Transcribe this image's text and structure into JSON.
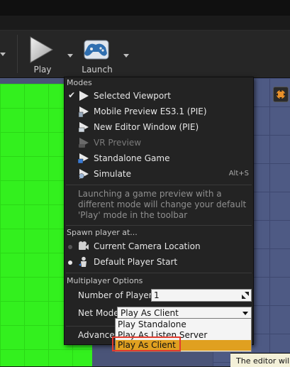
{
  "toolbar": {
    "play_label": "Play",
    "launch_label": "Launch"
  },
  "menu": {
    "modes_title": "Modes",
    "modes": [
      {
        "label": "Selected Viewport",
        "checked": true,
        "icon": "play-viewport-icon"
      },
      {
        "label": "Mobile Preview ES3.1 (PIE)",
        "icon": "play-mobile-icon"
      },
      {
        "label": "New Editor Window (PIE)",
        "icon": "play-window-icon"
      },
      {
        "label": "VR Preview",
        "disabled": true,
        "icon": "play-vr-icon"
      },
      {
        "label": "Standalone Game",
        "icon": "play-standalone-icon"
      },
      {
        "label": "Simulate",
        "shortcut": "Alt+S",
        "icon": "simulate-icon"
      }
    ],
    "description": "Launching a game preview with a different mode will change your default 'Play' mode in the toolbar",
    "spawn_title": "Spawn player at...",
    "spawn": [
      {
        "label": "Current Camera Location",
        "selected": false
      },
      {
        "label": "Default Player Start",
        "selected": true
      }
    ],
    "multiplayer_title": "Multiplayer Options",
    "num_players_label": "Number of Players",
    "num_players_value": "1",
    "net_mode_label": "Net Mode",
    "net_mode_value": "Play As Client",
    "advanced_label": "Advanced Settings..."
  },
  "net_mode_options": [
    {
      "label": "Play Standalone"
    },
    {
      "label": "Play As Listen Server"
    },
    {
      "label": "Play As Client",
      "selected": true
    }
  ],
  "tooltip_fragment": "The editor will a",
  "colors": {
    "highlight": "#e0a020",
    "annotation_box": "#e23b2e"
  }
}
